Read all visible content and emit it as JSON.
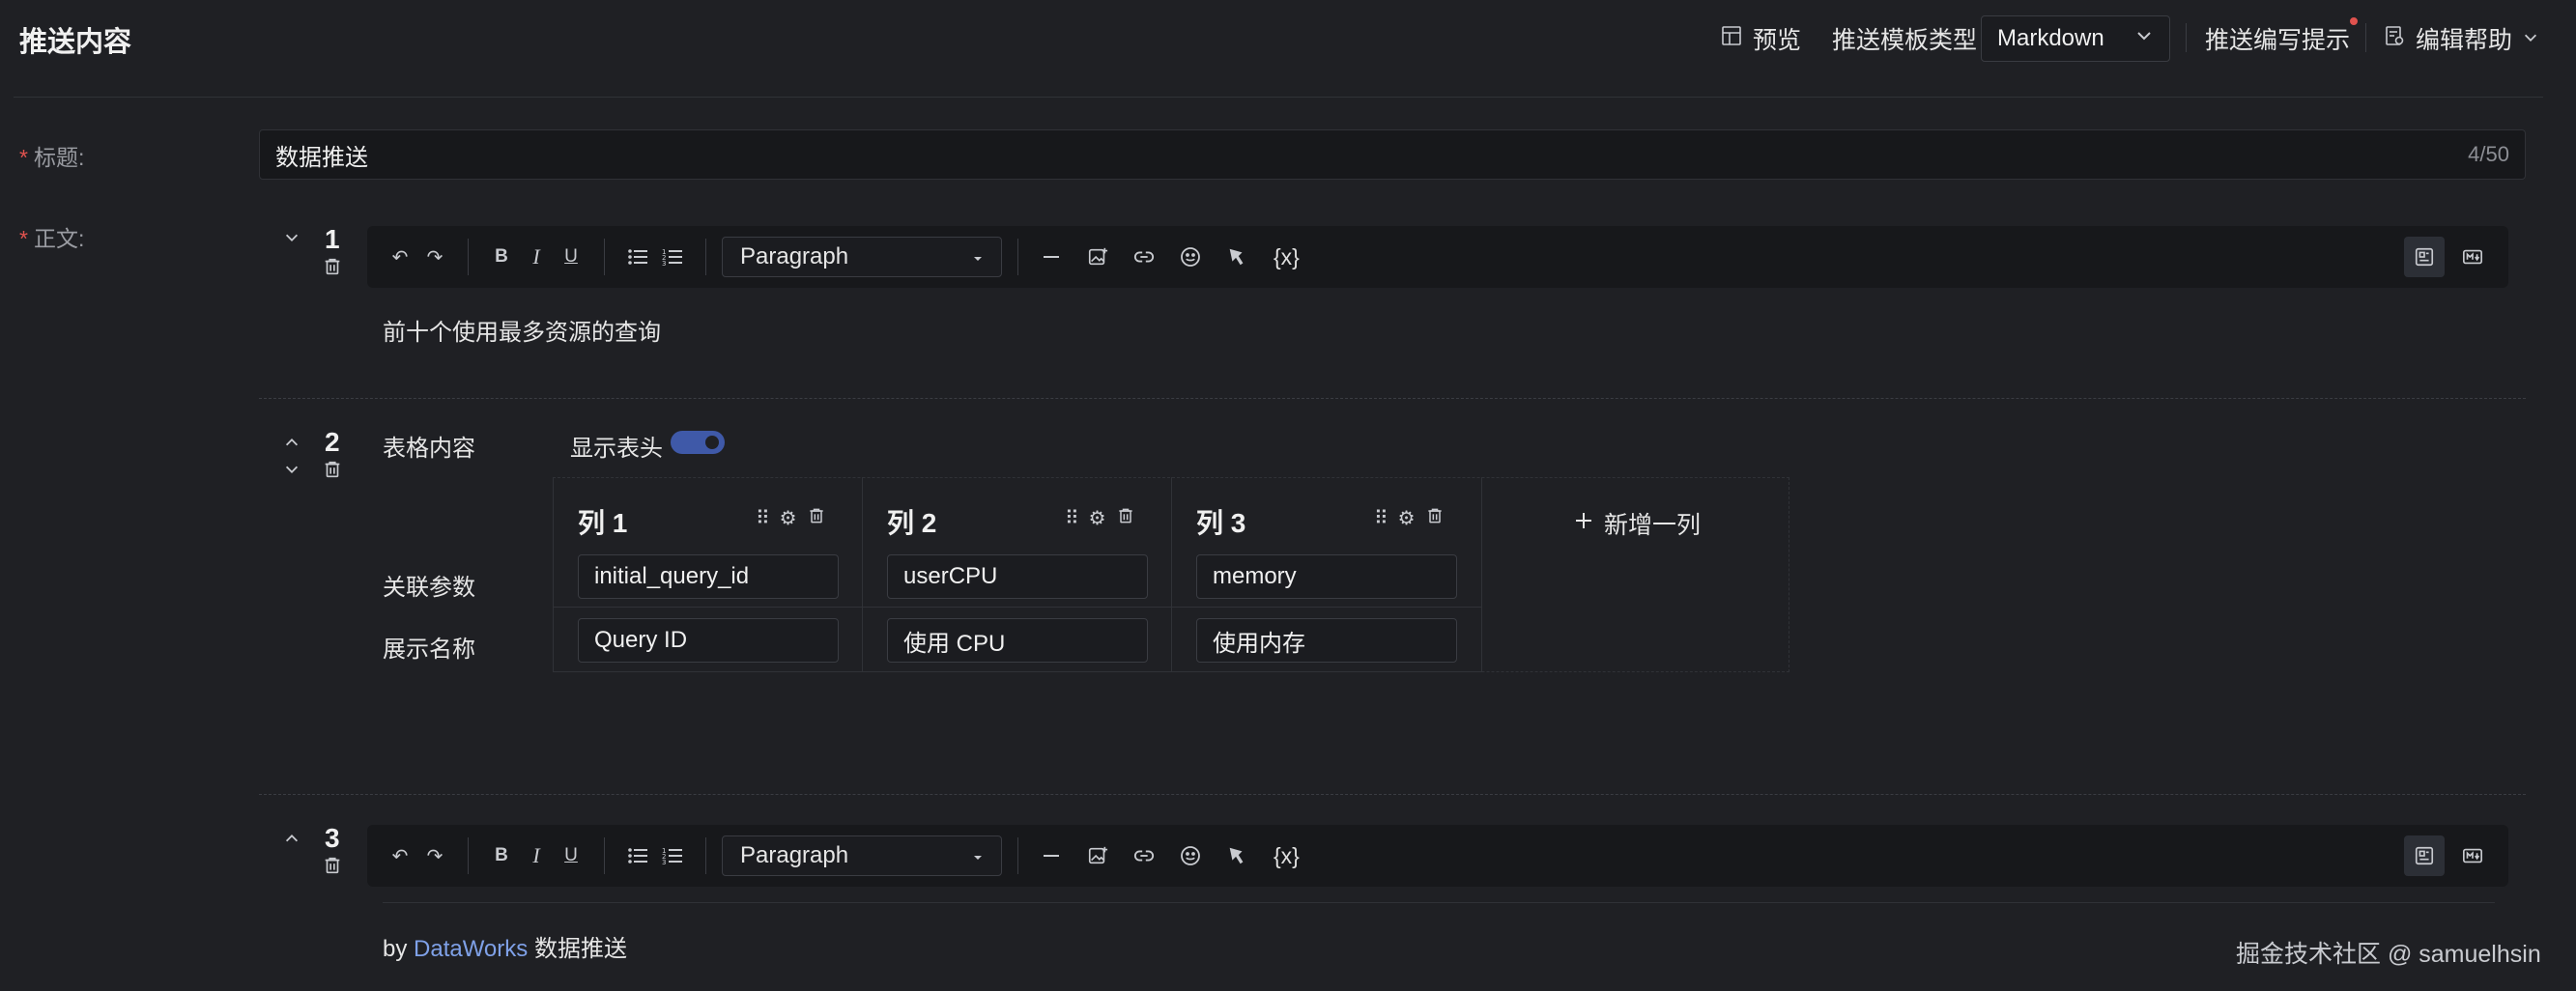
{
  "header": {
    "title": "推送内容",
    "preview_label": "预览",
    "template_type_label": "推送模板类型",
    "template_type_value": "Markdown",
    "hint_label": "推送编写提示",
    "help_label": "编辑帮助"
  },
  "form": {
    "required_mark": "*",
    "title_label": "标题:",
    "title_value": "数据推送",
    "title_counter": "4/50",
    "body_label": "正文:"
  },
  "blocks": [
    {
      "number": "1",
      "paragraph_style": "Paragraph",
      "variable_label": "{x}",
      "content": "前十个使用最多资源的查询"
    },
    {
      "number": "2",
      "table_title": "表格内容",
      "show_header_label": "显示表头",
      "show_header_on": true,
      "row_labels": [
        "关联参数",
        "展示名称"
      ],
      "columns": [
        {
          "header": "列 1",
          "param": "initial_query_id",
          "display": "Query ID"
        },
        {
          "header": "列 2",
          "param": "userCPU",
          "display": "使用 CPU"
        },
        {
          "header": "列 3",
          "param": "memory",
          "display": "使用内存"
        }
      ],
      "add_column_label": "新增一列"
    },
    {
      "number": "3",
      "paragraph_style": "Paragraph",
      "variable_label": "{x}",
      "content_prefix": "by ",
      "content_link": "DataWorks",
      "content_suffix": " 数据推送"
    }
  ],
  "watermark": "掘金技术社区 @ samuelhsin",
  "colors": {
    "background": "#1f2024",
    "accent": "#3f59a8",
    "link": "#7fa1e8",
    "required": "#e0524e"
  }
}
